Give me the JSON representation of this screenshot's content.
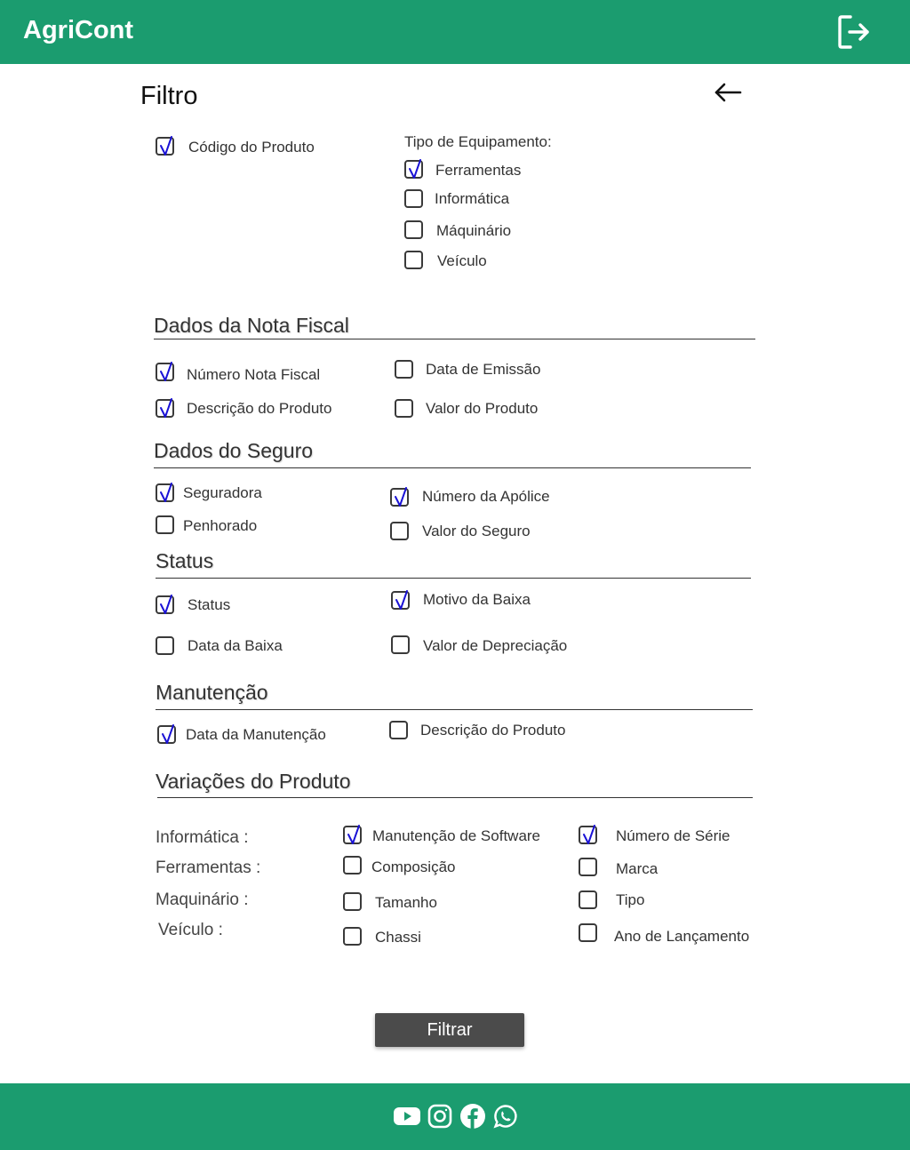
{
  "app": {
    "title": "AgriCont"
  },
  "page": {
    "title": "Filtro"
  },
  "top": {
    "codigo": {
      "label": "Código do Produto",
      "checked": true
    },
    "tipo_title": "Tipo de Equipamento:",
    "tipos": [
      {
        "label": "Ferramentas",
        "checked": true
      },
      {
        "label": "Informática",
        "checked": false
      },
      {
        "label": "Máquinário",
        "checked": false
      },
      {
        "label": "Veículo",
        "checked": false
      }
    ]
  },
  "nota": {
    "title": "Dados da Nota Fiscal",
    "items": [
      {
        "label": "Número Nota Fiscal",
        "checked": true
      },
      {
        "label": "Data de Emissão",
        "checked": false
      },
      {
        "label": "Descrição do Produto",
        "checked": true
      },
      {
        "label": "Valor do Produto",
        "checked": false
      }
    ]
  },
  "seguro": {
    "title": "Dados do Seguro",
    "items": [
      {
        "label": "Seguradora",
        "checked": true
      },
      {
        "label": "Número da Apólice",
        "checked": true
      },
      {
        "label": "Penhorado",
        "checked": false
      },
      {
        "label": "Valor do Seguro",
        "checked": false
      }
    ]
  },
  "status": {
    "title": "Status",
    "items": [
      {
        "label": "Status",
        "checked": true
      },
      {
        "label": "Motivo da Baixa",
        "checked": true
      },
      {
        "label": "Data da Baixa",
        "checked": false
      },
      {
        "label": "Valor de Depreciação",
        "checked": false
      }
    ]
  },
  "manut": {
    "title": "Manutenção",
    "items": [
      {
        "label": "Data da Manutenção",
        "checked": true
      },
      {
        "label": "Descrição do Produto",
        "checked": false
      }
    ]
  },
  "var": {
    "title": "Variações do Produto",
    "rows": [
      {
        "label": "Informática :",
        "a": {
          "label": "Manutenção de Software",
          "checked": true
        },
        "b": {
          "label": "Número de Série",
          "checked": true
        }
      },
      {
        "label": "Ferramentas :",
        "a": {
          "label": "Composição",
          "checked": false
        },
        "b": {
          "label": "Marca",
          "checked": false
        }
      },
      {
        "label": "Maquinário :",
        "a": {
          "label": "Tamanho",
          "checked": false
        },
        "b": {
          "label": "Tipo",
          "checked": false
        }
      },
      {
        "label": "Veículo :",
        "a": {
          "label": "Chassi",
          "checked": false
        },
        "b": {
          "label": "Ano de Lançamento",
          "checked": false
        }
      }
    ]
  },
  "button": {
    "filter": "Filtrar"
  },
  "icons": {
    "logout": "logout-icon",
    "back": "arrow-left-icon",
    "social": [
      "youtube-icon",
      "instagram-icon",
      "facebook-icon",
      "whatsapp-icon"
    ]
  },
  "colors": {
    "brand": "#1b9c6f",
    "button": "#4b4b4b",
    "check": "#1a12d6"
  }
}
